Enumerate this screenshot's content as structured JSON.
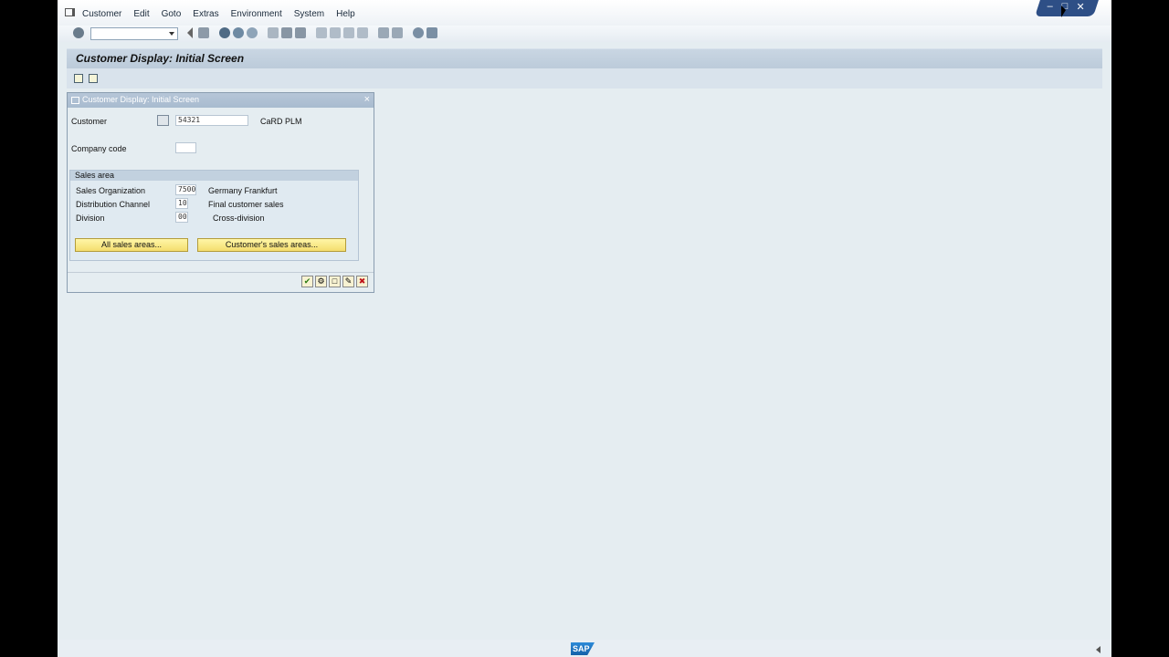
{
  "menu": {
    "items": [
      "Customer",
      "Edit",
      "Goto",
      "Extras",
      "Environment",
      "System",
      "Help"
    ]
  },
  "window_controls": [
    "–",
    "□",
    "✕"
  ],
  "page_title": "Customer Display: Initial Screen",
  "dialog": {
    "title": "Customer Display: Initial Screen",
    "customer_label": "Customer",
    "customer_value": "54321",
    "customer_name": "CaRD PLM",
    "company_code_label": "Company code",
    "company_code_value": "",
    "sales_area": {
      "header": "Sales area",
      "sales_org_label": "Sales Organization",
      "sales_org_value": "7500",
      "sales_org_desc": "Germany Frankfurt",
      "dist_channel_label": "Distribution Channel",
      "dist_channel_value": "10",
      "dist_channel_desc": "Final customer sales",
      "division_label": "Division",
      "division_value": "00",
      "division_desc": "Cross-division"
    },
    "all_sales_areas_label": "All sales areas...",
    "customer_sales_areas_label": "Customer's sales areas..."
  },
  "status": {
    "logo_text": "SAP"
  }
}
